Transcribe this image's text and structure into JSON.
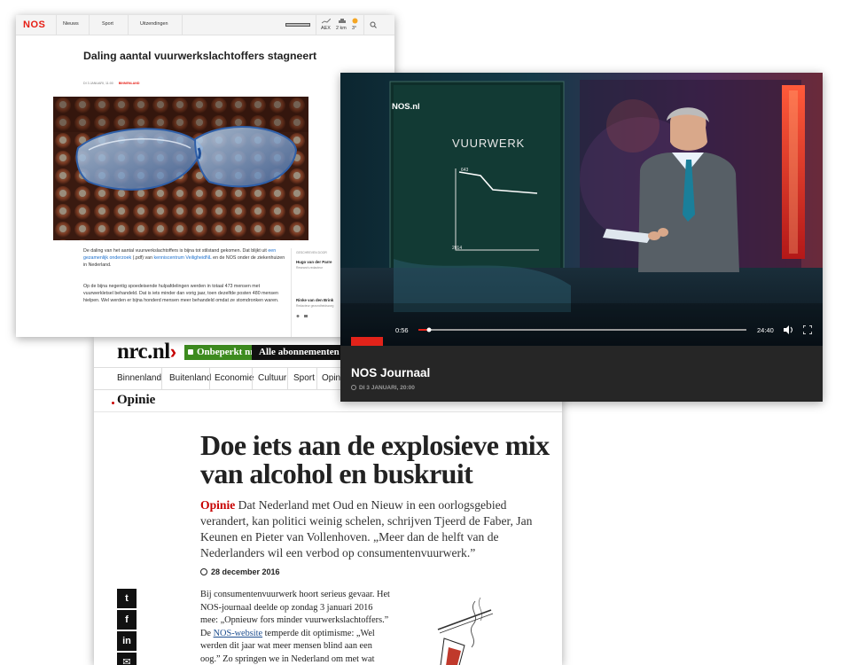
{
  "nrc": {
    "logo_text": "nrc.nl",
    "logo_chevron": "›",
    "subscribe_label": "Onbeperkt nrc.nl",
    "all_subs_label": "Alle abonnementen",
    "nav": [
      "Binnenland",
      "Buitenland",
      "Economie",
      "Cultuur",
      "Sport",
      "Opini"
    ],
    "section": "Opinie",
    "headline": "Doe iets aan de explosieve mix van alcohol en buskruit",
    "lead_tag": "Opinie",
    "lead_text": " Dat Nederland met Oud en Nieuw in een oorlogsgebied verandert, kan politici weinig schelen, schrijven Tjeerd de Faber, Jan Keunen en Pieter van Vollenhoven. „Meer dan de helft van de Nederlanders wil een verbod op consumentenvuurwerk.”",
    "date": "28 december 2016",
    "body_1": "Bij consumentenvuurwerk hoort serieus gevaar. Het NOS-journaal deelde op zondag 3 januari 2016 mee: „Opnieuw fors minder vuurwerkslachtoffers.” De ",
    "body_link": "NOS-website",
    "body_2": " temperde dit optimisme: „Wel werden dit jaar wat meer mensen blind aan een oog.” Zo springen we in Nederland om met wat",
    "share_icons": [
      "twitter-icon",
      "facebook-icon",
      "linkedin-icon",
      "mail-icon"
    ],
    "share_glyphs": [
      "t",
      "f",
      "in",
      "✉"
    ]
  },
  "nos": {
    "logo": "NOS",
    "nav": [
      "Nieuws",
      "Sport",
      "Uitzendingen"
    ],
    "ticker": [
      "AEX",
      "2 km",
      "3°"
    ],
    "title": "Daling aantal vuurwerkslachtoffers stagneert",
    "meta_date": "DI 3 JANUARI, 11:00",
    "meta_category": "BINNENLAND",
    "p1_a": "De daling van het aantal vuurwerkslachtoffers is bijna tot stilstand gekomen. Dat blijkt uit ",
    "p1_link1": "een gezamenlijk onderzoek",
    "p1_b": " (.pdf) van ",
    "p1_link2": "kenniscentrum VeiligheidNL",
    "p1_c": " en de NOS onder de ziekenhuizen in Nederland.",
    "p2": "Op de bijna negentig spoedeisende hulpafdelingen werden in totaal 473 mensen met vuurwerkletsel behandeld. Dat is iets minder dan vorig jaar, toen dezelfde posten 480 mensen hielpen. Wel werden er bijna honderd mensen meer behandeld omdat ze stomdronken waren.",
    "byline_label": "GESCHREVEN DOOR",
    "authors": [
      {
        "name": "Hugo van der Parre",
        "role": "Research-redacteur"
      },
      {
        "name": "Rinke van den Brink",
        "role": "Redacteur gezondheidszorg"
      }
    ]
  },
  "video": {
    "channel_bug": "NOS.nl",
    "board_title": "VUURWERK",
    "chart_value_top": "643",
    "chart_year_bottom": "2014",
    "time_elapsed": "0:56",
    "time_total": "24:40",
    "progress": 0.02,
    "title": "NOS Journaal",
    "date": "DI 3 JANUARI, 20:00"
  }
}
